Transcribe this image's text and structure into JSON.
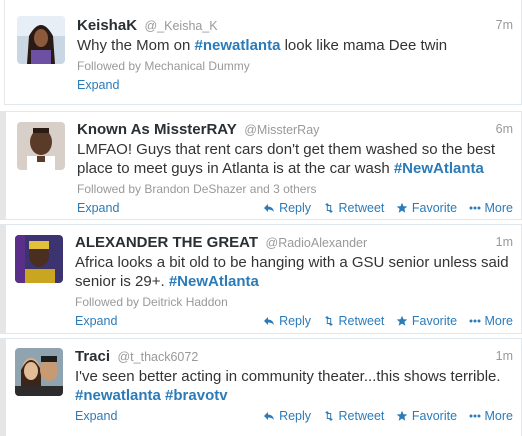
{
  "colors": {
    "link": "#2b7bb9",
    "muted": "#999999",
    "text": "#333333"
  },
  "icons": {
    "reply": "reply-icon",
    "retweet": "retweet-icon",
    "favorite": "star-icon",
    "more": "more-dots-icon"
  },
  "tweets": [
    {
      "fullname": "KeishaK",
      "username": "@_Keisha_K",
      "time": "7m",
      "text_pre": "Why the Mom on ",
      "hashtag1": "#newatlanta",
      "text_post": " look like mama Dee twin",
      "followed": "Followed by Mechanical Dummy",
      "expand": "Expand"
    },
    {
      "fullname": "Known As MissterRAY",
      "username": "@MissterRay",
      "time": "6m",
      "text_pre": "LMFAO! Guys that rent cars don't get them washed so the best place to meet guys in Atlanta is at the car wash ",
      "hashtag1": "#NewAtlanta",
      "followed": "Followed by Brandon DeShazer and 3 others",
      "expand": "Expand",
      "reply": "Reply",
      "retweet": "Retweet",
      "favorite": "Favorite",
      "more": "More"
    },
    {
      "fullname": "ALEXANDER THE GREAT",
      "username": "@RadioAlexander",
      "time": "1m",
      "text_pre": "Africa looks a bit old to be hanging with a GSU senior unless said senior is 29+. ",
      "hashtag1": "#NewAtlanta",
      "followed": "Followed by Deitrick Haddon",
      "expand": "Expand",
      "reply": "Reply",
      "retweet": "Retweet",
      "favorite": "Favorite",
      "more": "More"
    },
    {
      "fullname": "Traci",
      "username": "@t_thack6072",
      "time": "1m",
      "text_pre": "I've seen better acting in community theater...this shows terrible.",
      "hashtag1": "#newatlanta",
      "hashtag2": "#bravotv",
      "expand": "Expand",
      "reply": "Reply",
      "retweet": "Retweet",
      "favorite": "Favorite",
      "more": "More"
    }
  ]
}
